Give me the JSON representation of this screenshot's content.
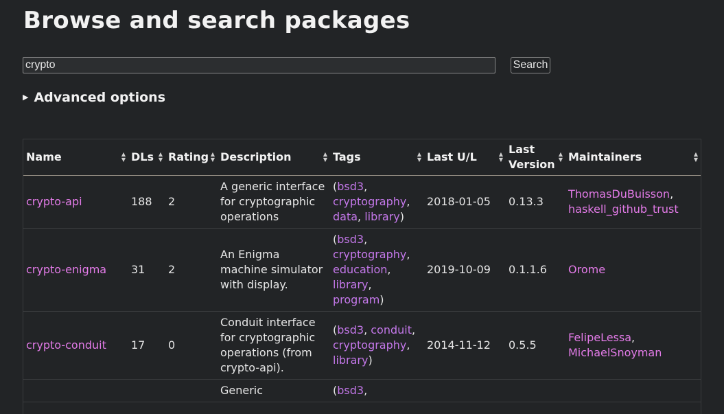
{
  "page": {
    "title": "Browse and search packages"
  },
  "search": {
    "value": "crypto",
    "button_label": "Search"
  },
  "advanced": {
    "label": "Advanced options",
    "toggle_glyph": "▶"
  },
  "table": {
    "headers": {
      "name": "Name",
      "dls": "DLs",
      "rating": "Rating",
      "description": "Description",
      "tags": "Tags",
      "last_ul": "Last U/L",
      "last_version_1": "Last",
      "last_version_2": "Version",
      "maintainers": "Maintainers"
    },
    "rows": [
      {
        "name": "crypto-api",
        "dls": "188",
        "rating": "2",
        "description": "A generic interface for cryptographic operations",
        "tags": [
          "bsd3",
          "cryptography",
          "data",
          "library"
        ],
        "last_ul": "2018-01-05",
        "last_version": "0.13.3",
        "maintainers": [
          "ThomasDuBuisson",
          "haskell_github_trust"
        ]
      },
      {
        "name": "crypto-enigma",
        "dls": "31",
        "rating": "2",
        "description": "An Enigma machine simulator with display.",
        "tags": [
          "bsd3",
          "cryptography",
          "education",
          "library",
          "program"
        ],
        "last_ul": "2019-10-09",
        "last_version": "0.1.1.6",
        "maintainers": [
          "Orome"
        ]
      },
      {
        "name": "crypto-conduit",
        "dls": "17",
        "rating": "0",
        "description": "Conduit interface for cryptographic operations (from crypto-api).",
        "tags": [
          "bsd3",
          "conduit",
          "cryptography",
          "library"
        ],
        "last_ul": "2014-11-12",
        "last_version": "0.5.5",
        "maintainers": [
          "FelipeLessa",
          "MichaelSnoyman"
        ]
      },
      {
        "name": "",
        "dls": "",
        "rating": "",
        "description": "Generic",
        "tags": [
          "bsd3"
        ],
        "last_ul": "",
        "last_version": "",
        "maintainers": []
      }
    ]
  },
  "colors": {
    "background": "#222426",
    "link": "#e37be8",
    "tag": "#c478ea"
  }
}
